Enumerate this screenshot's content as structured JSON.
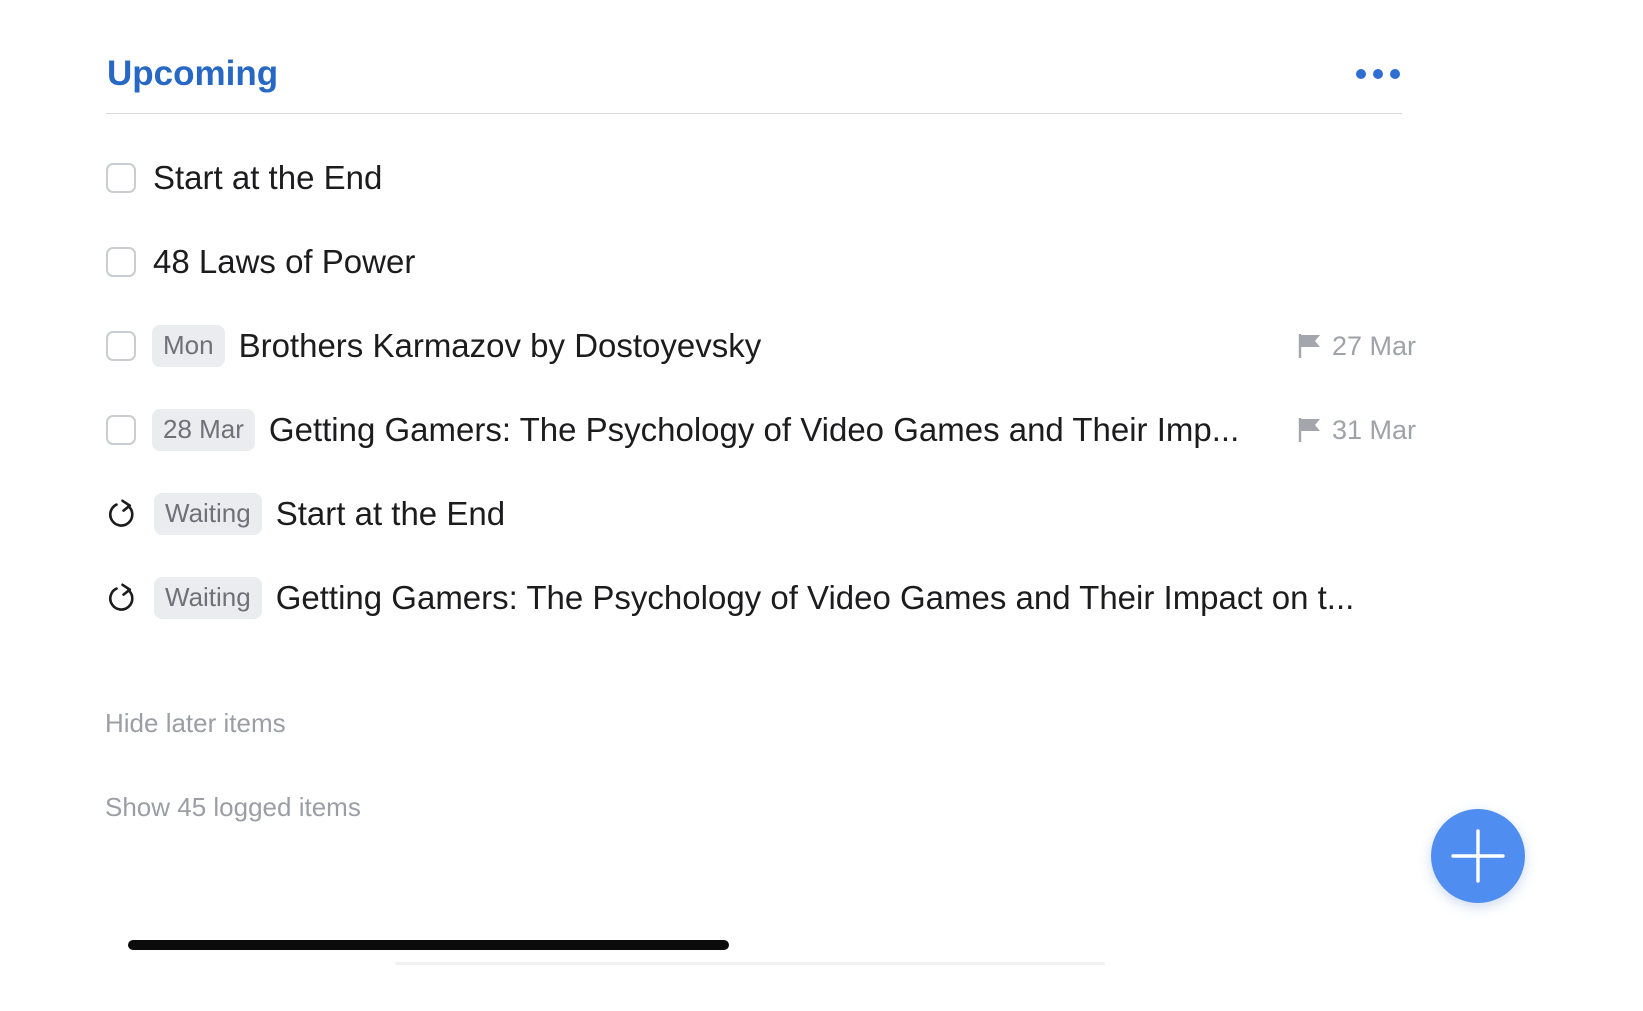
{
  "header": {
    "title": "Upcoming",
    "more_icon": "ellipsis-icon",
    "accent_color": "#2868c5"
  },
  "tasks": [
    {
      "kind": "checkbox",
      "tag": "",
      "title": "Start at the End",
      "deadline": ""
    },
    {
      "kind": "checkbox",
      "tag": "",
      "title": "48 Laws of Power",
      "deadline": ""
    },
    {
      "kind": "checkbox",
      "tag": "Mon",
      "title": "Brothers Karmazov by Dostoyevsky",
      "deadline": "27 Mar"
    },
    {
      "kind": "checkbox",
      "tag": "28 Mar",
      "title": "Getting Gamers: The Psychology of Video Games and Their Imp...",
      "deadline": "31 Mar"
    },
    {
      "kind": "repeat",
      "tag": "Waiting",
      "title": "Start at the End",
      "deadline": ""
    },
    {
      "kind": "repeat",
      "tag": "Waiting",
      "title": "Getting Gamers: The Psychology of Video Games and Their Impact on t...",
      "deadline": ""
    }
  ],
  "footer": {
    "hide_later": "Hide later items",
    "show_logged": "Show 45 logged items"
  },
  "fab": {
    "icon": "plus-icon",
    "color": "#4f8ef0"
  }
}
